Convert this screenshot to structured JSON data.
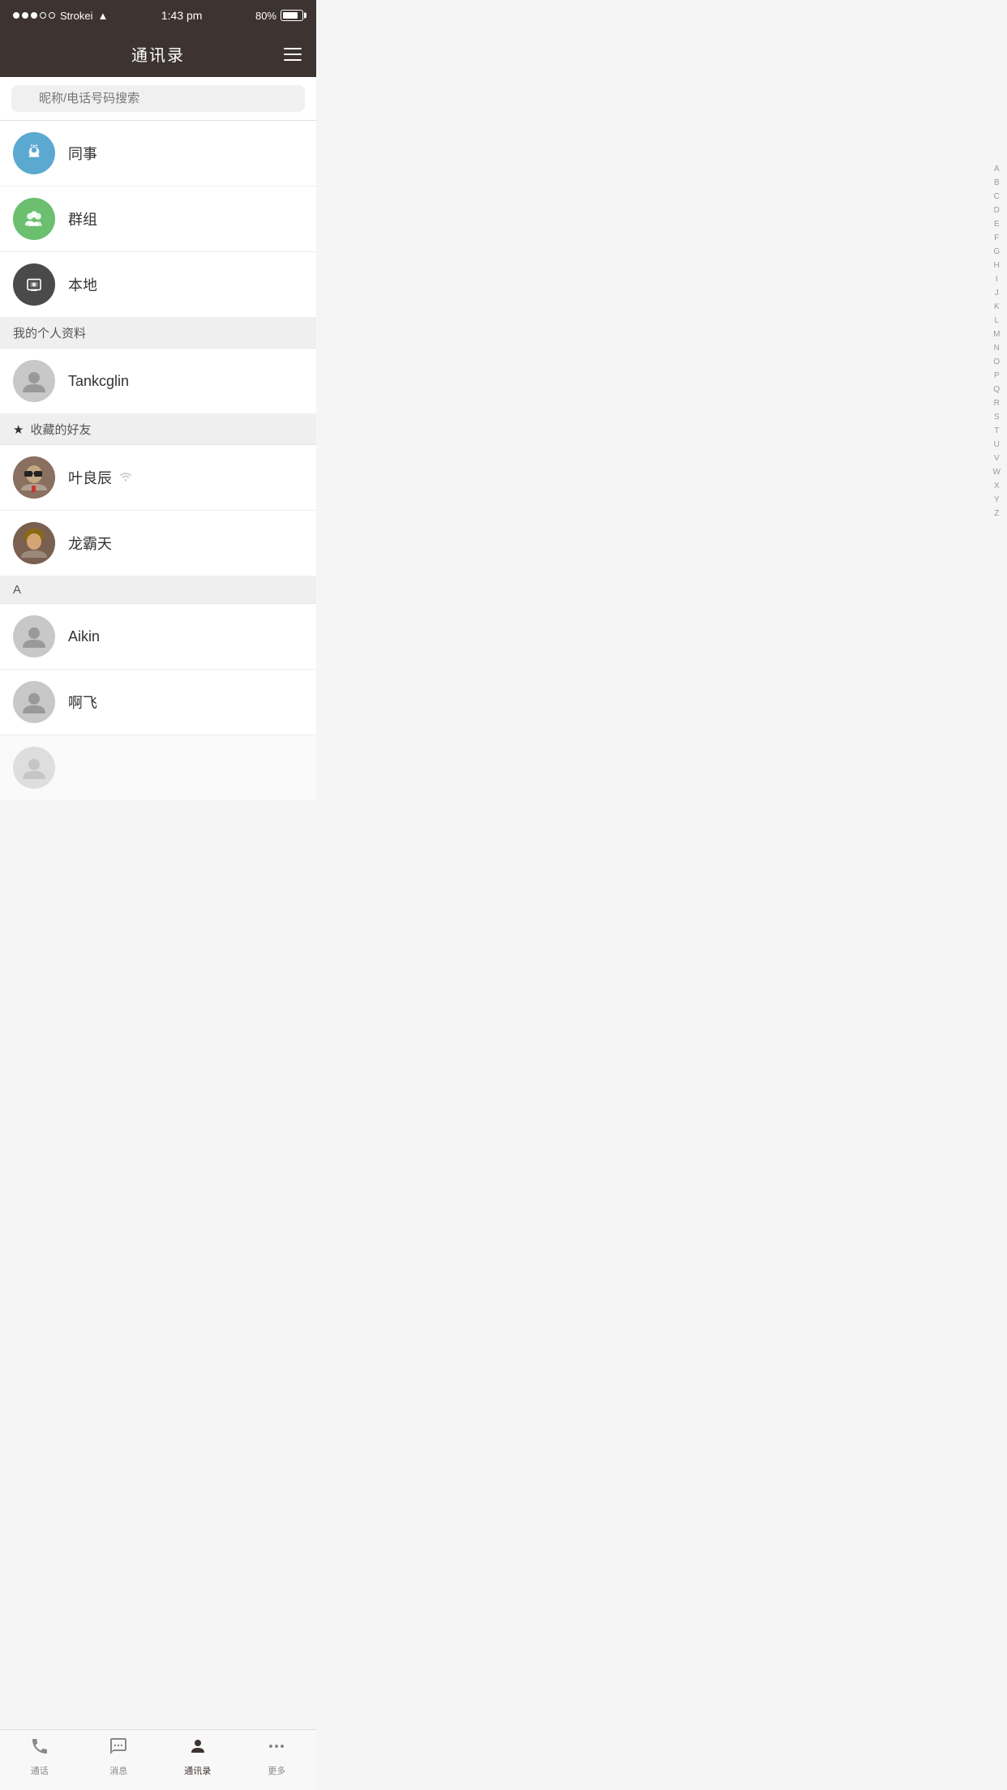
{
  "statusBar": {
    "carrier": "Strokei",
    "time": "1:43 pm",
    "battery": "80%"
  },
  "header": {
    "title": "通讯录",
    "menuLabel": "menu"
  },
  "search": {
    "placeholder": "昵称/电话号码搜索"
  },
  "quickCategories": [
    {
      "id": "colleagues",
      "icon": "colleagues",
      "label": "同事"
    },
    {
      "id": "groups",
      "icon": "groups",
      "label": "群组"
    },
    {
      "id": "local",
      "icon": "local",
      "label": "本地"
    }
  ],
  "sections": {
    "myProfile": {
      "label": "我的个人资料",
      "contact": {
        "name": "Tankcglin",
        "avatarType": "user"
      }
    },
    "favorites": {
      "label": "收藏的好友",
      "contacts": [
        {
          "name": "叶良辰",
          "avatarType": "ye",
          "online": true
        },
        {
          "name": "龙霸天",
          "avatarType": "long",
          "online": false
        }
      ]
    },
    "sectionA": {
      "label": "A",
      "contacts": [
        {
          "name": "Aikin",
          "avatarType": "user"
        },
        {
          "name": "啊飞",
          "avatarType": "user"
        }
      ]
    }
  },
  "alphabetIndex": [
    "A",
    "B",
    "C",
    "D",
    "E",
    "F",
    "G",
    "H",
    "I",
    "J",
    "K",
    "L",
    "M",
    "N",
    "O",
    "P",
    "Q",
    "R",
    "S",
    "T",
    "U",
    "V",
    "W",
    "X",
    "Y",
    "Z"
  ],
  "tabBar": {
    "tabs": [
      {
        "id": "calls",
        "icon": "phone",
        "label": "通话",
        "active": false
      },
      {
        "id": "messages",
        "icon": "chat",
        "label": "消息",
        "active": false
      },
      {
        "id": "contacts",
        "icon": "person",
        "label": "通讯录",
        "active": true
      },
      {
        "id": "more",
        "icon": "more",
        "label": "更多",
        "active": false
      }
    ]
  }
}
